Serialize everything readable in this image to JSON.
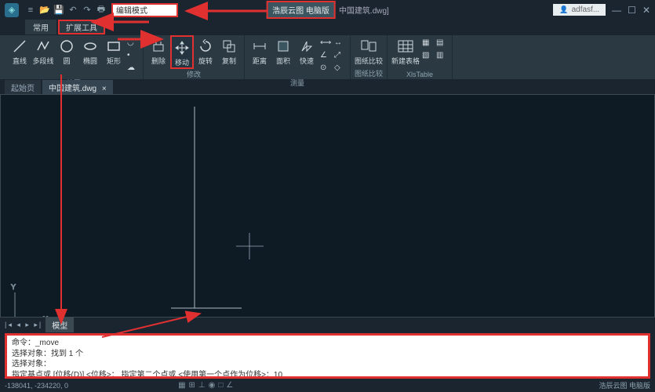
{
  "titlebar": {
    "search_text": "编辑模式",
    "brand": "浩辰云图 电脑版",
    "doc": "中国建筑.dwg]",
    "user": "adfasf..."
  },
  "tabs": {
    "t1": "常用",
    "t2": "扩展工具"
  },
  "ribbon": {
    "line": "直线",
    "pline": "多段线",
    "circle": "圆",
    "ellipse": "椭圆",
    "rect": "矩形",
    "erase": "删除",
    "move": "移动",
    "rotate": "旋转",
    "copy": "复制",
    "dist": "距离",
    "area": "面积",
    "quick": "快速",
    "dwgcmp": "图纸比较",
    "newtbl": "新建表格",
    "grp_draw": "绘图",
    "grp_modify": "修改",
    "grp_measure": "测量",
    "grp_dwgcmp": "图纸比较",
    "grp_xls": "XlsTable"
  },
  "doctabs": {
    "start": "起始页",
    "active": "中国建筑.dwg"
  },
  "bottom": {
    "model": "模型"
  },
  "cmd": {
    "l1": "命令：_move",
    "l2": "选择对象：找到 1 个",
    "l3": "选择对象：",
    "l4": "指定基点或 [位移(D)] <位移>：  指定第二个点或 <使用第一个点作为位移>：10"
  },
  "status": {
    "coords": "-138041, -234220, 0",
    "right": "浩辰云图 电脑版"
  }
}
